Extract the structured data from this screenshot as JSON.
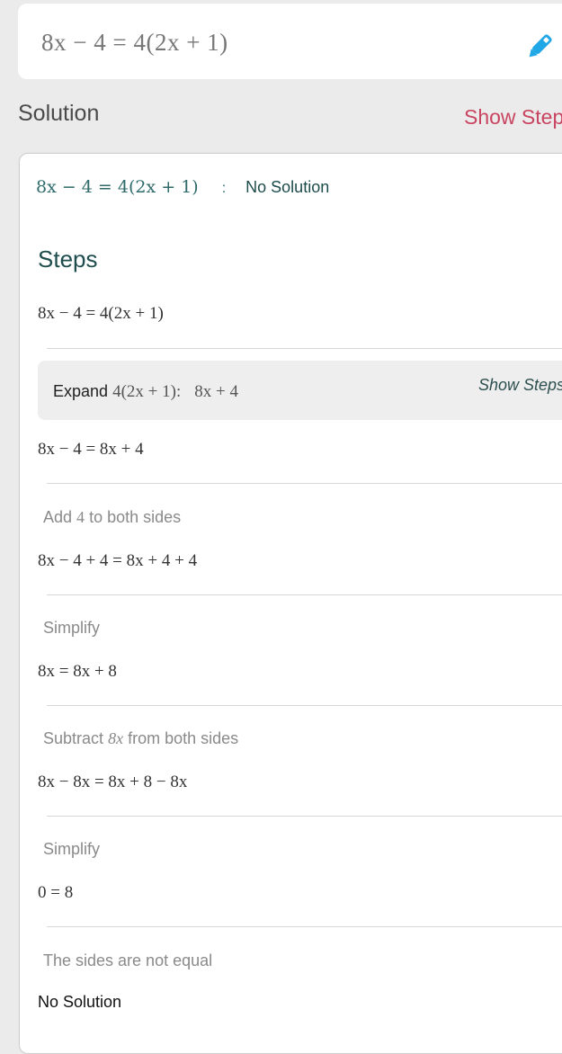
{
  "input": {
    "expression": "8x − 4 = 4(2x + 1)"
  },
  "icons": {
    "edit": "pencil-icon"
  },
  "colors": {
    "accent_red": "#c94461",
    "pencil_blue": "#1fa7e6",
    "teal_text": "#1f4d4d"
  },
  "solution": {
    "label": "Solution",
    "show_steps": "Show Steps",
    "equation": "8x − 4 = 4(2x + 1)",
    "separator": ":",
    "answer": "No Solution"
  },
  "steps": {
    "title": "Steps",
    "initial": "8x − 4 = 4(2x + 1)",
    "expand": {
      "label": "Expand",
      "expr": "4(2x + 1):",
      "result": "8x + 4",
      "show_steps": "Show Steps"
    },
    "items": [
      {
        "equation": "8x − 4 = 8x + 4"
      },
      {
        "caption_pre": "Add",
        "caption_math": "4",
        "caption_post": "to both sides",
        "equation": "8x − 4 + 4 = 8x + 4 + 4"
      },
      {
        "caption_pre": "Simplify",
        "caption_math": "",
        "caption_post": "",
        "equation": "8x = 8x + 8"
      },
      {
        "caption_pre": "Subtract",
        "caption_math": "8x",
        "caption_post": "from both sides",
        "equation": "8x − 8x = 8x + 8 − 8x"
      },
      {
        "caption_pre": "Simplify",
        "caption_math": "",
        "caption_post": "",
        "equation": "0 = 8"
      },
      {
        "caption_pre": "The sides are not equal",
        "caption_math": "",
        "caption_post": ""
      }
    ],
    "final": "No Solution"
  }
}
